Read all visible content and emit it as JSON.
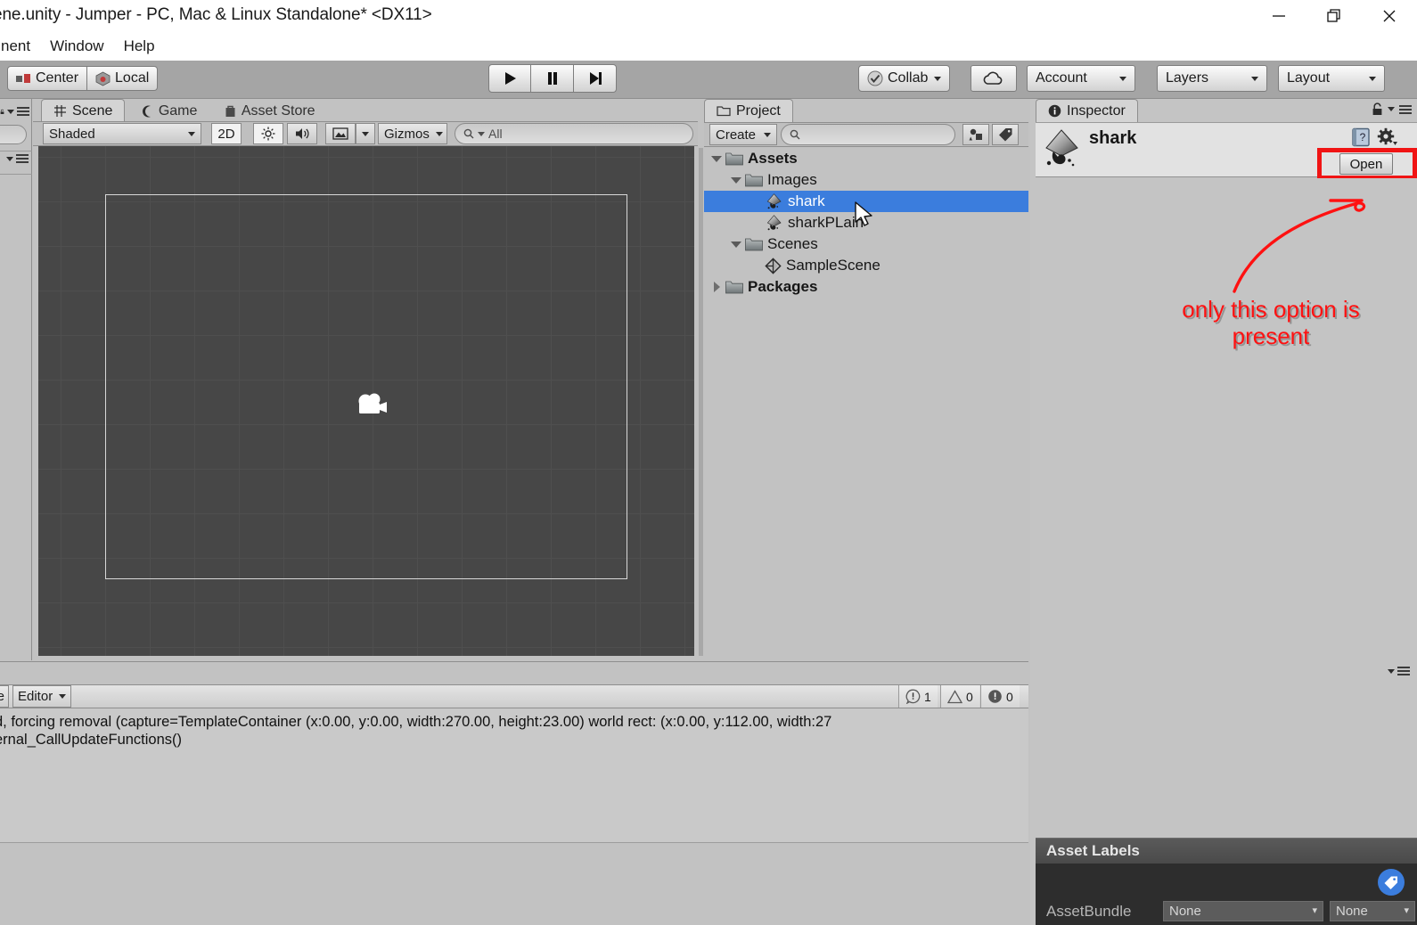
{
  "window": {
    "title": "ene.unity - Jumper - PC, Mac & Linux Standalone* <DX11>",
    "minimize_label": "minimize",
    "restore_label": "restore",
    "close_label": "close"
  },
  "menu": {
    "items": [
      {
        "label": "nent"
      },
      {
        "label": "Window"
      },
      {
        "label": "Help"
      }
    ]
  },
  "toolbar": {
    "pivot_mode": "Center",
    "pivot_rotation": "Local",
    "play": "play-icon",
    "pause": "pause-icon",
    "step": "step-icon",
    "collab": "Collab",
    "cloud": "cloud-icon",
    "account": "Account",
    "layers": "Layers",
    "layout": "Layout"
  },
  "scene_view": {
    "tabs": [
      {
        "label": "Scene",
        "icon": "grid-icon",
        "active": true
      },
      {
        "label": "Game",
        "icon": "gamepad-icon",
        "active": false
      },
      {
        "label": "Asset Store",
        "icon": "store-icon",
        "active": false
      }
    ],
    "draw_mode": "Shaded",
    "two_d": "2D",
    "lighting": "lighting-icon",
    "audio": "audio-icon",
    "effects": "image-icon",
    "gizmos": "Gizmos",
    "search_placeholder": "All",
    "search_value": "",
    "grid_color": "#4f4f4f",
    "background_color": "#474747",
    "camera_gizmo": "camera-icon"
  },
  "project": {
    "tab_label": "Project",
    "create_label": "Create",
    "search_value": "",
    "tree": [
      {
        "label": "Assets",
        "depth": 0,
        "arrow": "down",
        "icon": "folder-icon",
        "bold": true,
        "selected": false
      },
      {
        "label": "Images",
        "depth": 1,
        "arrow": "down",
        "icon": "folder-icon",
        "bold": false,
        "selected": false
      },
      {
        "label": "shark",
        "depth": 2,
        "arrow": "none",
        "icon": "inkscape-icon",
        "bold": false,
        "selected": true
      },
      {
        "label": "sharkPLain",
        "depth": 2,
        "arrow": "none",
        "icon": "inkscape-icon",
        "bold": false,
        "selected": false
      },
      {
        "label": "Scenes",
        "depth": 1,
        "arrow": "down",
        "icon": "folder-icon",
        "bold": false,
        "selected": false
      },
      {
        "label": "SampleScene",
        "depth": 2,
        "arrow": "none",
        "icon": "unity-icon",
        "bold": false,
        "selected": false
      },
      {
        "label": "Packages",
        "depth": 0,
        "arrow": "right",
        "icon": "folder-icon",
        "bold": true,
        "selected": false
      }
    ],
    "selection_color": "#3b7ddd"
  },
  "inspector": {
    "tab_label": "Inspector",
    "asset_name": "shark",
    "asset_icon": "inkscape-icon",
    "help_icon": "help-book-icon",
    "gear_icon": "gear-icon",
    "open_label": "Open",
    "highlight_color": "#f01414",
    "asset_labels_title": "Asset Labels",
    "tag_icon": "tag-icon",
    "assetbundle_label": "AssetBundle",
    "assetbundle_value": "None",
    "assetbundle_variant": "None"
  },
  "annotation": {
    "text_line1": "only this option is",
    "text_line2": "present",
    "color": "#ff1111"
  },
  "console": {
    "clear_label": "e",
    "editor_label": "Editor",
    "error_count": "1",
    "warning_count": "0",
    "info_count": "0",
    "log_lines": [
      "d, forcing removal (capture=TemplateContainer  (x:0.00, y:0.00, width:270.00, height:23.00) world rect: (x:0.00, y:112.00, width:27",
      "ernal_CallUpdateFunctions()"
    ]
  }
}
